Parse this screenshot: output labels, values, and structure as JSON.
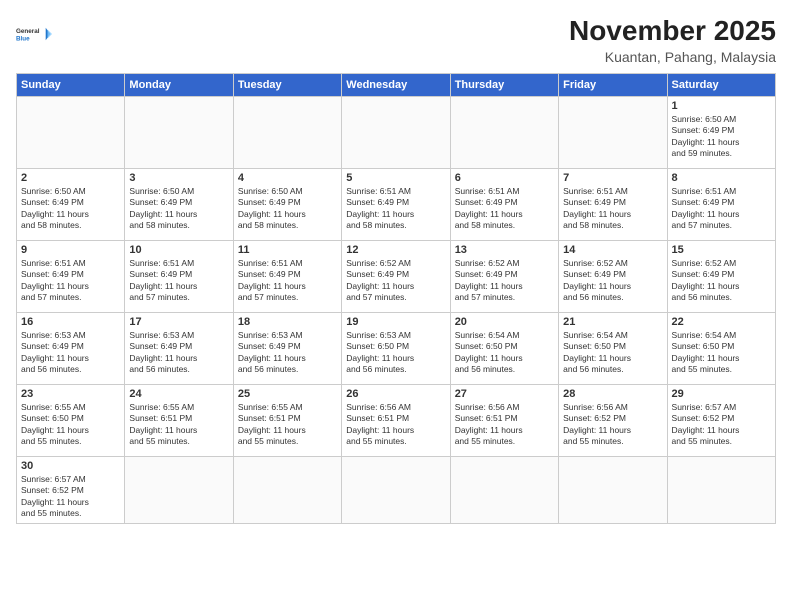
{
  "header": {
    "logo_line1": "General",
    "logo_line2": "Blue",
    "month_year": "November 2025",
    "location": "Kuantan, Pahang, Malaysia"
  },
  "days_of_week": [
    "Sunday",
    "Monday",
    "Tuesday",
    "Wednesday",
    "Thursday",
    "Friday",
    "Saturday"
  ],
  "weeks": [
    [
      {
        "day": "",
        "info": ""
      },
      {
        "day": "",
        "info": ""
      },
      {
        "day": "",
        "info": ""
      },
      {
        "day": "",
        "info": ""
      },
      {
        "day": "",
        "info": ""
      },
      {
        "day": "",
        "info": ""
      },
      {
        "day": "1",
        "info": "Sunrise: 6:50 AM\nSunset: 6:49 PM\nDaylight: 11 hours\nand 59 minutes."
      }
    ],
    [
      {
        "day": "2",
        "info": "Sunrise: 6:50 AM\nSunset: 6:49 PM\nDaylight: 11 hours\nand 58 minutes."
      },
      {
        "day": "3",
        "info": "Sunrise: 6:50 AM\nSunset: 6:49 PM\nDaylight: 11 hours\nand 58 minutes."
      },
      {
        "day": "4",
        "info": "Sunrise: 6:50 AM\nSunset: 6:49 PM\nDaylight: 11 hours\nand 58 minutes."
      },
      {
        "day": "5",
        "info": "Sunrise: 6:51 AM\nSunset: 6:49 PM\nDaylight: 11 hours\nand 58 minutes."
      },
      {
        "day": "6",
        "info": "Sunrise: 6:51 AM\nSunset: 6:49 PM\nDaylight: 11 hours\nand 58 minutes."
      },
      {
        "day": "7",
        "info": "Sunrise: 6:51 AM\nSunset: 6:49 PM\nDaylight: 11 hours\nand 58 minutes."
      },
      {
        "day": "8",
        "info": "Sunrise: 6:51 AM\nSunset: 6:49 PM\nDaylight: 11 hours\nand 57 minutes."
      }
    ],
    [
      {
        "day": "9",
        "info": "Sunrise: 6:51 AM\nSunset: 6:49 PM\nDaylight: 11 hours\nand 57 minutes."
      },
      {
        "day": "10",
        "info": "Sunrise: 6:51 AM\nSunset: 6:49 PM\nDaylight: 11 hours\nand 57 minutes."
      },
      {
        "day": "11",
        "info": "Sunrise: 6:51 AM\nSunset: 6:49 PM\nDaylight: 11 hours\nand 57 minutes."
      },
      {
        "day": "12",
        "info": "Sunrise: 6:52 AM\nSunset: 6:49 PM\nDaylight: 11 hours\nand 57 minutes."
      },
      {
        "day": "13",
        "info": "Sunrise: 6:52 AM\nSunset: 6:49 PM\nDaylight: 11 hours\nand 57 minutes."
      },
      {
        "day": "14",
        "info": "Sunrise: 6:52 AM\nSunset: 6:49 PM\nDaylight: 11 hours\nand 56 minutes."
      },
      {
        "day": "15",
        "info": "Sunrise: 6:52 AM\nSunset: 6:49 PM\nDaylight: 11 hours\nand 56 minutes."
      }
    ],
    [
      {
        "day": "16",
        "info": "Sunrise: 6:53 AM\nSunset: 6:49 PM\nDaylight: 11 hours\nand 56 minutes."
      },
      {
        "day": "17",
        "info": "Sunrise: 6:53 AM\nSunset: 6:49 PM\nDaylight: 11 hours\nand 56 minutes."
      },
      {
        "day": "18",
        "info": "Sunrise: 6:53 AM\nSunset: 6:49 PM\nDaylight: 11 hours\nand 56 minutes."
      },
      {
        "day": "19",
        "info": "Sunrise: 6:53 AM\nSunset: 6:50 PM\nDaylight: 11 hours\nand 56 minutes."
      },
      {
        "day": "20",
        "info": "Sunrise: 6:54 AM\nSunset: 6:50 PM\nDaylight: 11 hours\nand 56 minutes."
      },
      {
        "day": "21",
        "info": "Sunrise: 6:54 AM\nSunset: 6:50 PM\nDaylight: 11 hours\nand 56 minutes."
      },
      {
        "day": "22",
        "info": "Sunrise: 6:54 AM\nSunset: 6:50 PM\nDaylight: 11 hours\nand 55 minutes."
      }
    ],
    [
      {
        "day": "23",
        "info": "Sunrise: 6:55 AM\nSunset: 6:50 PM\nDaylight: 11 hours\nand 55 minutes."
      },
      {
        "day": "24",
        "info": "Sunrise: 6:55 AM\nSunset: 6:51 PM\nDaylight: 11 hours\nand 55 minutes."
      },
      {
        "day": "25",
        "info": "Sunrise: 6:55 AM\nSunset: 6:51 PM\nDaylight: 11 hours\nand 55 minutes."
      },
      {
        "day": "26",
        "info": "Sunrise: 6:56 AM\nSunset: 6:51 PM\nDaylight: 11 hours\nand 55 minutes."
      },
      {
        "day": "27",
        "info": "Sunrise: 6:56 AM\nSunset: 6:51 PM\nDaylight: 11 hours\nand 55 minutes."
      },
      {
        "day": "28",
        "info": "Sunrise: 6:56 AM\nSunset: 6:52 PM\nDaylight: 11 hours\nand 55 minutes."
      },
      {
        "day": "29",
        "info": "Sunrise: 6:57 AM\nSunset: 6:52 PM\nDaylight: 11 hours\nand 55 minutes."
      }
    ],
    [
      {
        "day": "30",
        "info": "Sunrise: 6:57 AM\nSunset: 6:52 PM\nDaylight: 11 hours\nand 55 minutes."
      },
      {
        "day": "",
        "info": ""
      },
      {
        "day": "",
        "info": ""
      },
      {
        "day": "",
        "info": ""
      },
      {
        "day": "",
        "info": ""
      },
      {
        "day": "",
        "info": ""
      },
      {
        "day": "",
        "info": ""
      }
    ]
  ]
}
